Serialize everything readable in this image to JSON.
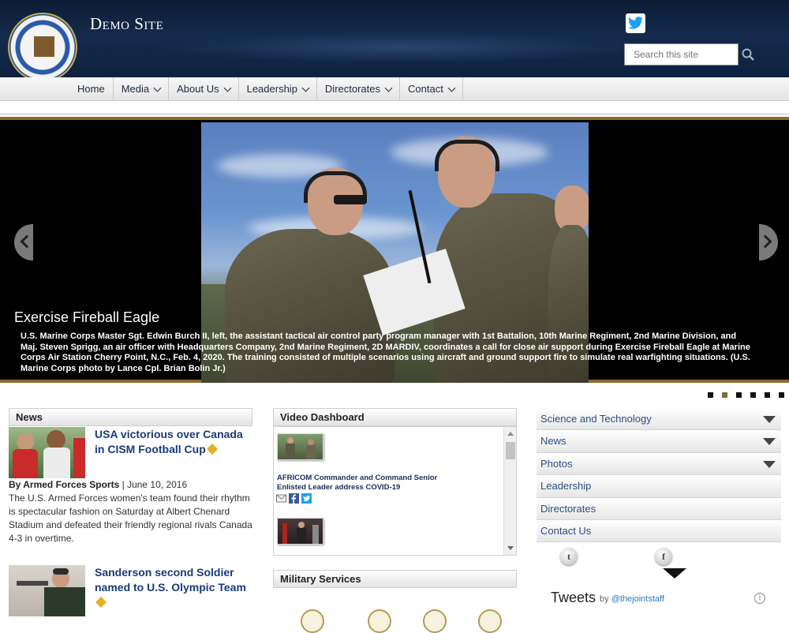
{
  "header": {
    "site_title": "Demo Site",
    "search_placeholder": "Search this site",
    "seal_alt": "Department of Defense United States of America"
  },
  "nav": {
    "items": [
      {
        "label": "Home",
        "dropdown": false
      },
      {
        "label": "Media",
        "dropdown": true
      },
      {
        "label": "About Us",
        "dropdown": true
      },
      {
        "label": "Leadership",
        "dropdown": true
      },
      {
        "label": "Directorates",
        "dropdown": true
      },
      {
        "label": "Contact",
        "dropdown": true
      }
    ]
  },
  "slider": {
    "title": "Exercise Fireball Eagle",
    "caption": "U.S. Marine Corps Master Sgt. Edwin Burch II, left, the assistant tactical air control party program manager with 1st Battalion, 10th Marine Regiment, 2nd Marine Division, and Maj. Steven Sprigg, an air officer with Headquarters Company, 2nd Marine Regiment, 2D MARDIV, coordinates a call for close air support during Exercise Fireball Eagle at Marine Corps Air Station Cherry Point, N.C., Feb. 4, 2020. The training consisted of multiple scenarios using aircraft and ground support fire to simulate real warfighting situations. (U.S. Marine Corps photo by Lance Cpl. Brian Bolin Jr.)",
    "dots_total": 6,
    "active_dot": 2
  },
  "news": {
    "heading": "News",
    "items": [
      {
        "title": "USA victorious over Canada in CISM Football Cup",
        "author": "By Armed Forces Sports",
        "date": "June 10, 2016",
        "summary": "The U.S. Armed Forces women's team found their rhythm is spectacular fashion on Saturday at Albert Chenard Stadium and defeated their friendly regional rivals Canada 4-3 in overtime."
      },
      {
        "title": "Sanderson second Soldier named to U.S. Olympic Team"
      }
    ],
    "separator": "|"
  },
  "video": {
    "heading": "Video Dashboard",
    "item_title": "AFRICOM Commander and Command Senior Enlisted Leader address COVID-19"
  },
  "military": {
    "heading": "Military Services"
  },
  "sidebar": {
    "items": [
      {
        "label": "Science and Technology",
        "expandable": true
      },
      {
        "label": "News",
        "expandable": true
      },
      {
        "label": "Photos",
        "expandable": true
      },
      {
        "label": "Leadership",
        "expandable": false
      },
      {
        "label": "Directorates",
        "expandable": false
      },
      {
        "label": "Contact Us",
        "expandable": false
      }
    ]
  },
  "social": {
    "twitter_glyph": "t",
    "facebook_glyph": "f"
  },
  "tweets": {
    "title": "Tweets",
    "by": "by",
    "handle": "@thejointstaff",
    "info": "i"
  },
  "colors": {
    "header_bg": "#142a4c",
    "accent_gold": "#8c6c2c",
    "link_blue": "#1a3a78",
    "twitter_blue": "#1da1f2"
  }
}
